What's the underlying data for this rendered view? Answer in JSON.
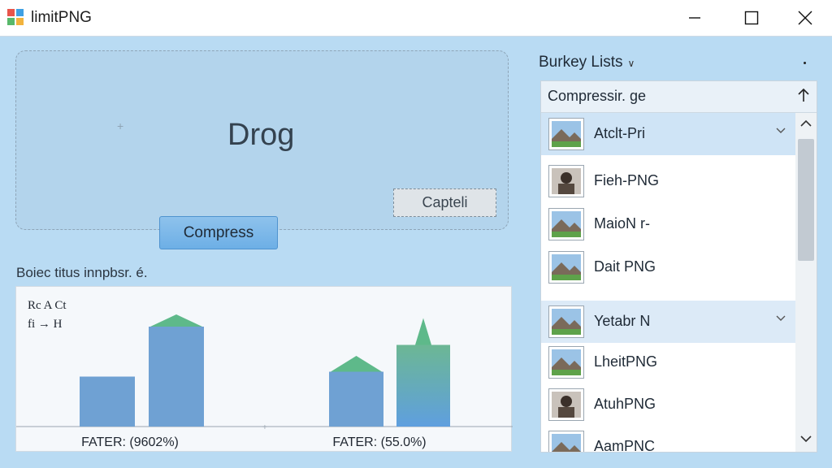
{
  "window": {
    "title": "limitPNG",
    "minimize_label": "Minimize",
    "maximize_label": "Maximize",
    "close_label": "Close"
  },
  "dropzone": {
    "text": "Drog",
    "cancel_label": "Capteli",
    "compress_label": "Compress"
  },
  "stats": {
    "section_label": "Boiec titus innpbsr. é.",
    "legend_line1": "Rc A Ct",
    "legend_line2": "fi → H",
    "colors": {
      "before": "#6fa1d3",
      "after": "#5eb98a"
    }
  },
  "chart_data": [
    {
      "type": "bar",
      "categories": [
        "",
        ""
      ],
      "series": [
        {
          "values": [
            41,
            82
          ]
        }
      ],
      "peak_marker": {
        "category_index": 1,
        "value": 92
      },
      "caption": "FATER: (9602%)"
    },
    {
      "type": "bar",
      "categories": [
        "",
        ""
      ],
      "series": [
        {
          "values": [
            45,
            67
          ]
        }
      ],
      "peak_markers": [
        {
          "category_index": 0,
          "value": 58
        },
        {
          "category_index": 1,
          "value": 89
        }
      ],
      "caption": "FATER: (55.0%)"
    }
  ],
  "sidebar": {
    "title": "Burkey Lists",
    "list_header": "Compressir. ge",
    "items": [
      {
        "label": "Atclt-Pri",
        "icon": "landscape-thumbnail-icon",
        "selected": true
      },
      {
        "label": "Fieh-PNG",
        "icon": "portrait-thumbnail-icon"
      },
      {
        "label": "MaioN r-",
        "icon": "landscape-thumbnail-icon"
      },
      {
        "label": "Dait PNG",
        "icon": "landscape-thumbnail-icon"
      },
      {
        "label": "Yetabr N",
        "icon": "landscape-thumbnail-icon",
        "hover": true
      },
      {
        "label": "LheitPNG",
        "icon": "landscape-thumbnail-icon"
      },
      {
        "label": "AtuhPNG",
        "icon": "portrait-thumbnail-icon"
      },
      {
        "label": "AamPNC",
        "icon": "landscape-thumbnail-icon"
      }
    ]
  }
}
